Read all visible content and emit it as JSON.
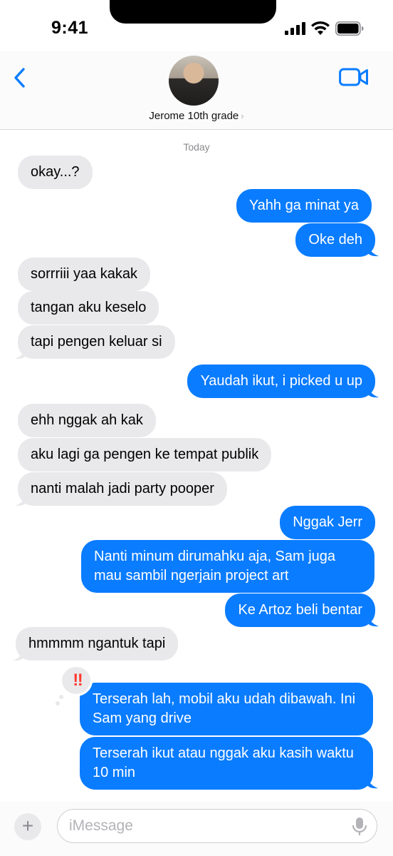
{
  "status_bar": {
    "time": "9:41"
  },
  "header": {
    "contact_name": "Jerome 10th grade",
    "chevron": "›"
  },
  "date_label": "Today",
  "messages": [
    {
      "text": "okay...?",
      "direction": "in"
    },
    {
      "text": "Yahh ga minat ya",
      "direction": "out"
    },
    {
      "text": "Oke deh",
      "direction": "out"
    },
    {
      "text": "sorrriii yaa kakak",
      "direction": "in"
    },
    {
      "text": "tangan aku keselo",
      "direction": "in"
    },
    {
      "text": "tapi pengen keluar si",
      "direction": "in"
    },
    {
      "text": "Yaudah ikut, i picked u up",
      "direction": "out"
    },
    {
      "text": "ehh nggak ah kak",
      "direction": "in"
    },
    {
      "text": "aku lagi ga pengen ke tempat publik",
      "direction": "in"
    },
    {
      "text": "nanti malah jadi party pooper",
      "direction": "in"
    },
    {
      "text": "Nggak Jerr",
      "direction": "out"
    },
    {
      "text": "Nanti minum dirumahku aja, Sam juga mau sambil ngerjain project art",
      "direction": "out"
    },
    {
      "text": "Ke Artoz beli bentar",
      "direction": "out"
    },
    {
      "text": "hmmmm ngantuk tapi",
      "direction": "in"
    },
    {
      "text": "Terserah lah, mobil aku udah dibawah. Ini Sam yang drive",
      "direction": "out"
    },
    {
      "text": "Terserah ikut atau nggak aku kasih waktu 10 min",
      "direction": "out"
    }
  ],
  "reaction": {
    "symbol": "‼",
    "icon": "double-exclamation-icon",
    "color": "#ff3b30"
  },
  "input": {
    "placeholder": "iMessage",
    "value": "",
    "plus_label": "+"
  },
  "colors": {
    "outgoing": "#0a7cff",
    "incoming": "#e9e9eb",
    "accent": "#0a7cff"
  }
}
